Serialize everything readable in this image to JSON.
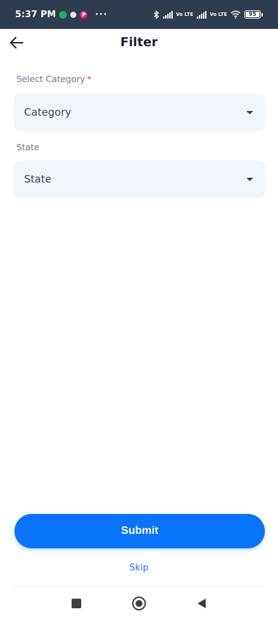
{
  "status_bar": {
    "time": "5:37 PM",
    "app_icon_letters": [
      "P"
    ],
    "more": "···",
    "volte_labels": [
      "Vo LTE",
      "Vo LTE"
    ],
    "battery_level": "95",
    "icons": [
      "whatsapp-icon",
      "dot-icon",
      "app-p-icon",
      "bluetooth-icon",
      "signal-icon",
      "wifi-icon",
      "battery-icon"
    ]
  },
  "header": {
    "title": "Filter",
    "back_icon": "arrow-left-icon"
  },
  "form": {
    "category": {
      "label": "Select Category",
      "required_mark": "*",
      "value": "Category"
    },
    "state": {
      "label": "State",
      "value": "State"
    }
  },
  "actions": {
    "submit_label": "Submit",
    "skip_label": "Skip"
  },
  "navigation": {
    "icons": [
      "recents-square-icon",
      "home-circle-icon",
      "back-triangle-icon"
    ]
  },
  "colors": {
    "status_bar_bg": "#2f3b4f",
    "primary": "#0a73fb",
    "link": "#1a73e8",
    "required": "#e53935",
    "field_bg": "#f1f6fc"
  }
}
